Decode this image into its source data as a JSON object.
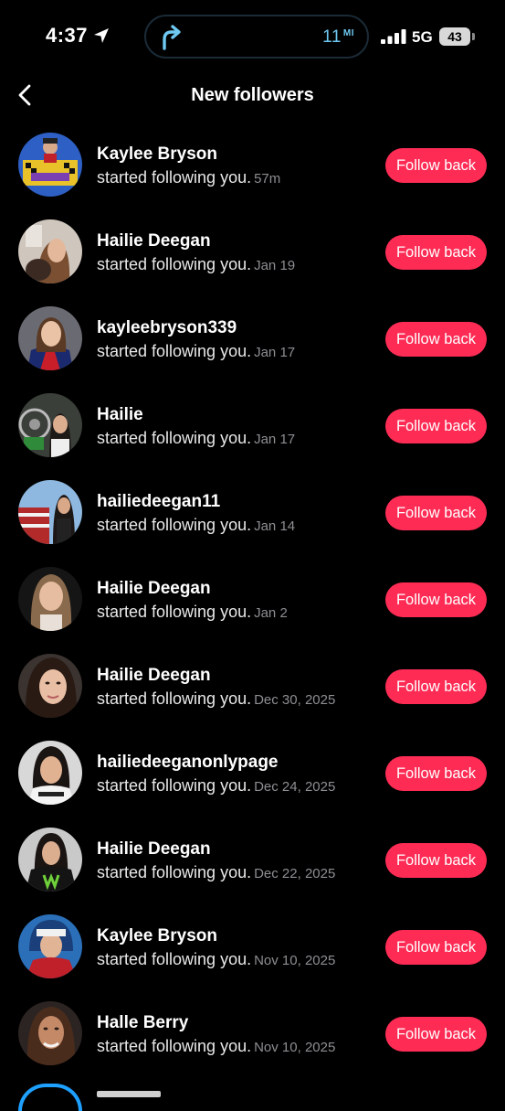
{
  "status_bar": {
    "time": "4:37",
    "nav_distance": "11",
    "nav_unit": "MI",
    "network": "5G",
    "battery": "43"
  },
  "header": {
    "title": "New followers"
  },
  "colors": {
    "accent": "#fe2c55",
    "background": "#000000",
    "timestamp": "#8e8e93",
    "nav_text": "#6ec8f2"
  },
  "followers": [
    {
      "name": "Kaylee Bryson",
      "action": "started following you.",
      "time": "57m",
      "button": "Follow back"
    },
    {
      "name": "Hailie Deegan",
      "action": "started following you.",
      "time": "Jan 19",
      "button": "Follow back"
    },
    {
      "name": "kayleebryson339",
      "action": "started following you.",
      "time": "Jan 17",
      "button": "Follow back"
    },
    {
      "name": "Hailie",
      "action": "started following you.",
      "time": "Jan 17",
      "button": "Follow back"
    },
    {
      "name": "hailiedeegan11",
      "action": "started following you.",
      "time": "Jan 14",
      "button": "Follow back"
    },
    {
      "name": "Hailie Deegan",
      "action": "started following you.",
      "time": "Jan 2",
      "button": "Follow back"
    },
    {
      "name": "Hailie Deegan",
      "action": "started following you.",
      "time": "Dec 30, 2025",
      "button": "Follow back"
    },
    {
      "name": "hailiedeeganonlypage",
      "action": "started following you.",
      "time": "Dec 24, 2025",
      "button": "Follow back"
    },
    {
      "name": "Hailie Deegan",
      "action": "started following you.",
      "time": "Dec 22, 2025",
      "button": "Follow back"
    },
    {
      "name": "Kaylee Bryson",
      "action": "started following you.",
      "time": "Nov 10, 2025",
      "button": "Follow back"
    },
    {
      "name": "Halle Berry",
      "action": "started following you.",
      "time": "Nov 10, 2025",
      "button": "Follow back"
    }
  ]
}
